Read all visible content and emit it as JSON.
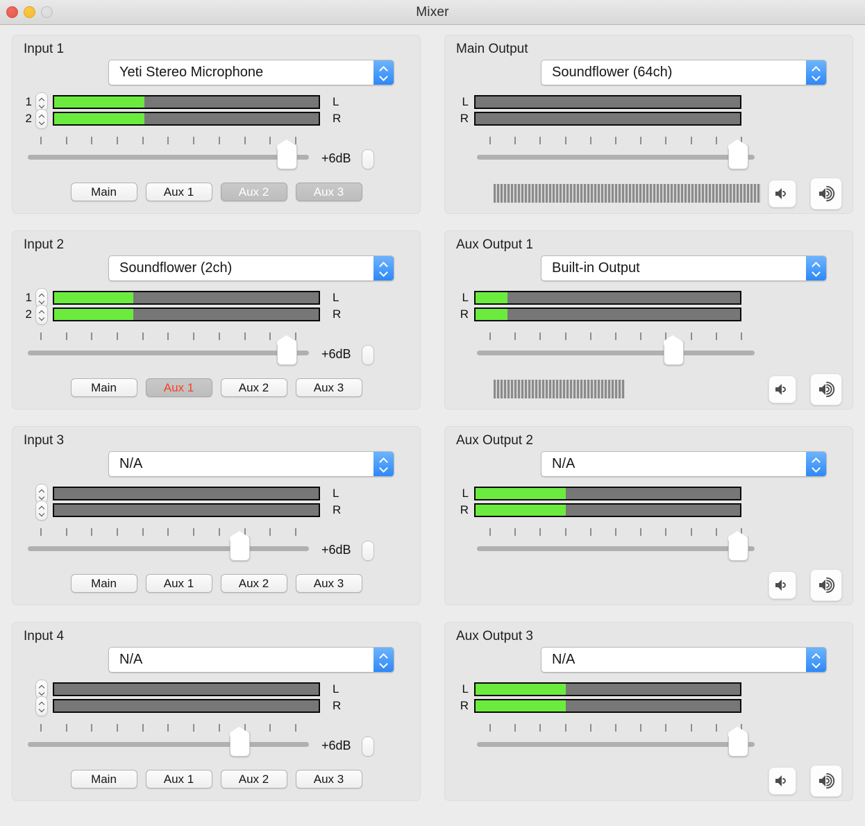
{
  "window": {
    "title": "Mixer",
    "traffic_lights": [
      {
        "name": "close",
        "color": "#e4584c"
      },
      {
        "name": "minimize",
        "color": "#f5b92f"
      },
      {
        "name": "zoom",
        "color": "#d6d6d6"
      }
    ]
  },
  "colors": {
    "meter_green": "#6ceb3f",
    "meter_track": "#777777",
    "accent_blue": "#2e88f7",
    "alert_red": "#ff3b20",
    "panel_bg": "#e6e6e6",
    "window_bg": "#ececec"
  },
  "labels": {
    "left": "L",
    "right": "R",
    "db_value": "+6dB",
    "tick_count": 11
  },
  "inputs": [
    {
      "title": "Input 1",
      "device": "Yeti Stereo Microphone",
      "channels": [
        "1",
        "2"
      ],
      "show_channel_numbers": true,
      "meters": [
        {
          "label": "L",
          "level_pct": 34
        },
        {
          "label": "R",
          "level_pct": 34
        }
      ],
      "gain_label": "+6dB",
      "gain_pct": 95,
      "routes": [
        {
          "label": "Main",
          "active": false
        },
        {
          "label": "Aux 1",
          "active": false
        },
        {
          "label": "Aux 2",
          "active": true
        },
        {
          "label": "Aux 3",
          "active": true
        }
      ]
    },
    {
      "title": "Input 2",
      "device": "Soundflower (2ch)",
      "channels": [
        "1",
        "2"
      ],
      "show_channel_numbers": true,
      "meters": [
        {
          "label": "L",
          "level_pct": 30
        },
        {
          "label": "R",
          "level_pct": 30
        }
      ],
      "gain_label": "+6dB",
      "gain_pct": 95,
      "routes": [
        {
          "label": "Main",
          "active": false
        },
        {
          "label": "Aux 1",
          "active": true,
          "alert": true
        },
        {
          "label": "Aux 2",
          "active": false
        },
        {
          "label": "Aux 3",
          "active": false
        }
      ]
    },
    {
      "title": "Input 3",
      "device": "N/A",
      "channels": [
        "",
        ""
      ],
      "show_channel_numbers": false,
      "meters": [
        {
          "label": "L",
          "level_pct": 0
        },
        {
          "label": "R",
          "level_pct": 0
        }
      ],
      "gain_label": "+6dB",
      "gain_pct": 77,
      "routes": [
        {
          "label": "Main",
          "active": false
        },
        {
          "label": "Aux 1",
          "active": false
        },
        {
          "label": "Aux 2",
          "active": false
        },
        {
          "label": "Aux 3",
          "active": false
        }
      ]
    },
    {
      "title": "Input 4",
      "device": "N/A",
      "channels": [
        "",
        ""
      ],
      "show_channel_numbers": false,
      "meters": [
        {
          "label": "L",
          "level_pct": 0
        },
        {
          "label": "R",
          "level_pct": 0
        }
      ],
      "gain_label": "+6dB",
      "gain_pct": 77,
      "routes": [
        {
          "label": "Main",
          "active": false
        },
        {
          "label": "Aux 1",
          "active": false
        },
        {
          "label": "Aux 2",
          "active": false
        },
        {
          "label": "Aux 3",
          "active": false
        }
      ]
    }
  ],
  "outputs": [
    {
      "title": "Main Output",
      "device": "Soundflower (64ch)",
      "meters": [
        {
          "label": "L",
          "level_pct": 0
        },
        {
          "label": "R",
          "level_pct": 0
        }
      ],
      "gain_pct": 97,
      "system_volume_pct": 100,
      "has_system_volume": true,
      "volume_down_icon": "speaker-low-icon",
      "volume_up_icon": "speaker-high-icon"
    },
    {
      "title": "Aux Output 1",
      "device": "Built-in Output",
      "meters": [
        {
          "label": "L",
          "level_pct": 12
        },
        {
          "label": "R",
          "level_pct": 12
        }
      ],
      "gain_pct": 72,
      "system_volume_pct": 49,
      "has_system_volume": true,
      "volume_down_icon": "speaker-low-icon",
      "volume_up_icon": "speaker-high-icon"
    },
    {
      "title": "Aux Output 2",
      "device": "N/A",
      "meters": [
        {
          "label": "L",
          "level_pct": 34
        },
        {
          "label": "R",
          "level_pct": 34
        }
      ],
      "gain_pct": 97,
      "system_volume_pct": 0,
      "has_system_volume": false,
      "volume_down_icon": "speaker-low-icon",
      "volume_up_icon": "speaker-high-icon"
    },
    {
      "title": "Aux Output 3",
      "device": "N/A",
      "meters": [
        {
          "label": "L",
          "level_pct": 34
        },
        {
          "label": "R",
          "level_pct": 34
        }
      ],
      "gain_pct": 97,
      "system_volume_pct": 0,
      "has_system_volume": false,
      "volume_down_icon": "speaker-low-icon",
      "volume_up_icon": "speaker-high-icon"
    }
  ]
}
